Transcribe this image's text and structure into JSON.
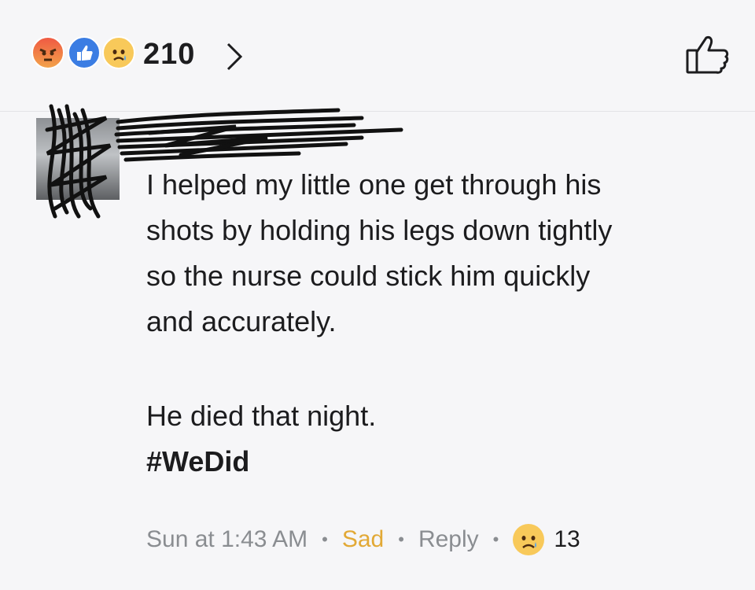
{
  "header": {
    "reaction_icons": [
      "angry-icon",
      "like-icon",
      "sad-icon"
    ],
    "reaction_count": "210"
  },
  "comment": {
    "lines": [
      "I helped my little one get through his",
      "shots by holding his legs down tightly",
      "so the nurse could stick him quickly",
      "and accurately."
    ],
    "second_paragraph": "He died that night.",
    "hashtag": "#WeDid"
  },
  "meta": {
    "timestamp": "Sun at 1:43 AM",
    "reaction_label": "Sad",
    "reply_label": "Reply",
    "reaction_count": "13"
  },
  "colors": {
    "sad_label": "#e2a936",
    "meta_text": "#8a8d91",
    "like_blue": "#3b7de3"
  }
}
